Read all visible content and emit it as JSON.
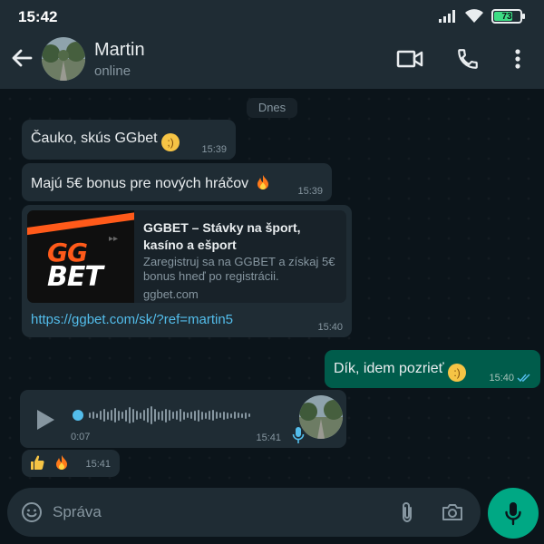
{
  "status_bar": {
    "time": "15:42",
    "battery": 73,
    "battery_label": "73"
  },
  "header": {
    "name": "Martin",
    "status": "online"
  },
  "chat": {
    "date": "Dnes",
    "messages": [
      {
        "text": "Čauko, skús GGbet",
        "time": "15:39",
        "emoji": "wink"
      },
      {
        "text": "Majú 5€ bonus pre nových hráčov",
        "time": "15:39",
        "emoji": "fire"
      },
      {
        "preview": {
          "title": "GGBET – Stávky na šport, kasíno a ešport",
          "description": "Zaregistruj sa na GGBET a získaj 5€ bonus hneď po registrácii.",
          "domain": "ggbet.com",
          "logo_top": "GG",
          "logo_bottom": "BET"
        },
        "link": "https://ggbet.com/sk/?ref=martin5",
        "time": "15:40"
      },
      {
        "text": "Dík, idem pozrieť",
        "time": "15:40",
        "emoji": "smile",
        "outgoing": true
      },
      {
        "voice": {
          "duration": "0:07",
          "progress": 0
        },
        "time": "15:41"
      },
      {
        "reaction": "thumbs-up fire",
        "time": "15:41"
      }
    ]
  },
  "composer": {
    "placeholder": "Správa"
  },
  "colors": {
    "accent": "#00a884",
    "outgoing": "#005c4b",
    "incoming": "#1f2c34",
    "link": "#53bdeb",
    "brand_orange": "#ff5a1a"
  },
  "icons": [
    "back-arrow-icon",
    "video-call-icon",
    "phone-icon",
    "more-vert-icon",
    "play-icon",
    "mic-icon",
    "emoji-icon",
    "attach-icon",
    "camera-icon",
    "double-check-icon"
  ]
}
